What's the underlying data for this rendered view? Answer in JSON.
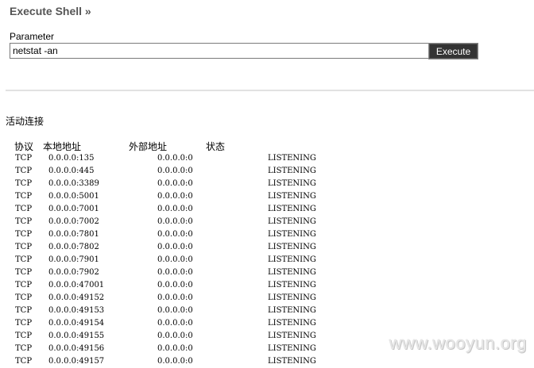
{
  "page": {
    "title": "Execute Shell »",
    "parameter_label": "Parameter",
    "parameter_value": "netstat -an",
    "execute_label": "Execute"
  },
  "output": {
    "heading": "活动连接",
    "columns": {
      "proto": "协议",
      "local": "本地地址",
      "foreign": "外部地址",
      "state": "状态"
    },
    "rows": [
      {
        "proto": "TCP",
        "local": "0.0.0.0:135",
        "foreign": "0.0.0.0:0",
        "state": "LISTENING"
      },
      {
        "proto": "TCP",
        "local": "0.0.0.0:445",
        "foreign": "0.0.0.0:0",
        "state": "LISTENING"
      },
      {
        "proto": "TCP",
        "local": "0.0.0.0:3389",
        "foreign": "0.0.0.0:0",
        "state": "LISTENING"
      },
      {
        "proto": "TCP",
        "local": "0.0.0.0:5001",
        "foreign": "0.0.0.0:0",
        "state": "LISTENING"
      },
      {
        "proto": "TCP",
        "local": "0.0.0.0:7001",
        "foreign": "0.0.0.0:0",
        "state": "LISTENING"
      },
      {
        "proto": "TCP",
        "local": "0.0.0.0:7002",
        "foreign": "0.0.0.0:0",
        "state": "LISTENING"
      },
      {
        "proto": "TCP",
        "local": "0.0.0.0:7801",
        "foreign": "0.0.0.0:0",
        "state": "LISTENING"
      },
      {
        "proto": "TCP",
        "local": "0.0.0.0:7802",
        "foreign": "0.0.0.0:0",
        "state": "LISTENING"
      },
      {
        "proto": "TCP",
        "local": "0.0.0.0:7901",
        "foreign": "0.0.0.0:0",
        "state": "LISTENING"
      },
      {
        "proto": "TCP",
        "local": "0.0.0.0:7902",
        "foreign": "0.0.0.0:0",
        "state": "LISTENING"
      },
      {
        "proto": "TCP",
        "local": "0.0.0.0:47001",
        "foreign": "0.0.0.0:0",
        "state": "LISTENING"
      },
      {
        "proto": "TCP",
        "local": "0.0.0.0:49152",
        "foreign": "0.0.0.0:0",
        "state": "LISTENING"
      },
      {
        "proto": "TCP",
        "local": "0.0.0.0:49153",
        "foreign": "0.0.0.0:0",
        "state": "LISTENING"
      },
      {
        "proto": "TCP",
        "local": "0.0.0.0:49154",
        "foreign": "0.0.0.0:0",
        "state": "LISTENING"
      },
      {
        "proto": "TCP",
        "local": "0.0.0.0:49155",
        "foreign": "0.0.0.0:0",
        "state": "LISTENING"
      },
      {
        "proto": "TCP",
        "local": "0.0.0.0:49156",
        "foreign": "0.0.0.0:0",
        "state": "LISTENING"
      },
      {
        "proto": "TCP",
        "local": "0.0.0.0:49157",
        "foreign": "0.0.0.0:0",
        "state": "LISTENING"
      }
    ]
  },
  "watermark": "www.wooyun.org",
  "colors": {
    "title": "#555555",
    "button_bg": "#333333",
    "divider": "#e2e2e2"
  }
}
